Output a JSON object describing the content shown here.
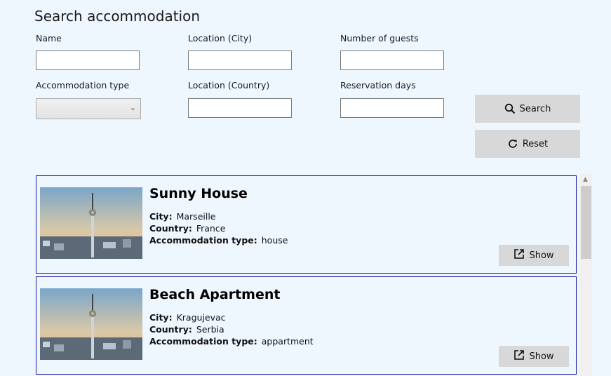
{
  "page": {
    "title": "Search accommodation"
  },
  "form": {
    "name": {
      "label": "Name",
      "value": ""
    },
    "city": {
      "label": "Location (City)",
      "value": ""
    },
    "guests": {
      "label": "Number of guests",
      "value": ""
    },
    "type": {
      "label": "Accommodation type",
      "selected": ""
    },
    "country": {
      "label": "Location (Country)",
      "value": ""
    },
    "days": {
      "label": "Reservation days",
      "value": ""
    },
    "search_label": "Search",
    "reset_label": "Reset"
  },
  "results": {
    "city_label": "City:",
    "country_label": "Country:",
    "type_label": "Accommodation type:",
    "show_label": "Show",
    "items": [
      {
        "name": "Sunny House",
        "city": "Marseille",
        "country": "France",
        "type": "house"
      },
      {
        "name": "Beach Apartment",
        "city": "Kragujevac",
        "country": "Serbia",
        "type": "appartment"
      }
    ]
  },
  "colors": {
    "background": "#eef6fe",
    "card_border": "#1a1aa0",
    "button": "#d8d8d8"
  }
}
